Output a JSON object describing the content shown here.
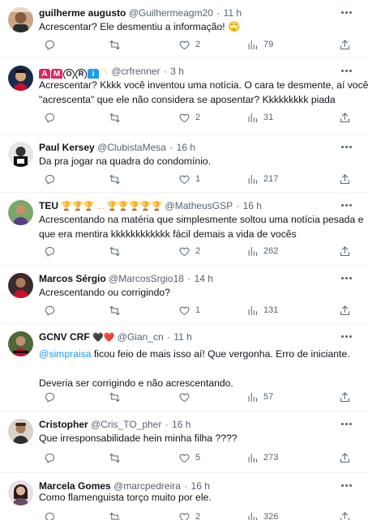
{
  "colors": {
    "accent": "#1d9bf0",
    "text": "#0f1419",
    "muted": "#536471",
    "divider": "#eff3f4"
  },
  "tweets": [
    {
      "name": "guilherme augusto",
      "handle": "@Guilhermeagm20",
      "time": "11 h",
      "text_lines": [
        "Acrescentar? Ele desmentiu a informação! 🙄"
      ],
      "replies": "",
      "retweets": "",
      "likes": "2",
      "views": "79"
    },
    {
      "name_badges": [
        "A",
        "M",
        "O",
        "R",
        "i",
        "〽"
      ],
      "handle": "@crfrenner",
      "time": "3 h",
      "text_lines": [
        "Acrescentar? Kkkk você inventou uma notícia. O cara te desmente, aí você",
        "\"acrescenta\" que ele não considera se aposentar? Kkkkkkkkk piada"
      ],
      "replies": "",
      "retweets": "",
      "likes": "2",
      "views": "31"
    },
    {
      "name": "Paul Kersey",
      "handle": "@ClubistaMesa",
      "time": "16 h",
      "text_lines": [
        "Da pra jogar na quadra do condomínio."
      ],
      "replies": "",
      "retweets": "",
      "likes": "1",
      "views": "217"
    },
    {
      "name": "TEU",
      "name_suffix": "🏆🏆🏆 ... 🏆🏆🏆🏆🏆",
      "handle": "@MatheusGSP",
      "time": "16 h",
      "text_lines": [
        "Acrescentando na matéria que simplesmente soltou uma notícia pesada e",
        "que era mentira  kkkkkkkkkkkk fácil demais a vida de vocês"
      ],
      "replies": "",
      "retweets": "",
      "likes": "2",
      "views": "262"
    },
    {
      "name": "Marcos Sérgio",
      "handle": "@MarcosSrgio18",
      "time": "14 h",
      "text_lines": [
        "Acrescentando ou corrigindo?"
      ],
      "replies": "",
      "retweets": "",
      "likes": "1",
      "views": "131"
    },
    {
      "name": "GCNV CRF",
      "name_suffix": "🖤❤️",
      "handle": "@Gian_cn",
      "time": "11 h",
      "mention": "@simpraisa",
      "text_lines": [
        " ficou feio de mais isso aí! Que vergonha. Erro de iniciante.",
        "",
        "Deveria ser corrigindo e não acrescentando."
      ],
      "replies": "",
      "retweets": "",
      "likes": "",
      "views": "57"
    },
    {
      "name": "Cristopher",
      "handle": "@Cris_TO_pher",
      "time": "16 h",
      "text_lines": [
        "Que irresponsabilidade hein minha filha ????"
      ],
      "replies": "",
      "retweets": "",
      "likes": "5",
      "views": "273"
    },
    {
      "name": "Marcela Gomes",
      "handle": "@marcpedreira",
      "time": "16 h",
      "text_lines": [
        "Como flamenguista torço muito por ele."
      ],
      "replies": "",
      "retweets": "",
      "likes": "2",
      "views": "326"
    }
  ],
  "icons": {
    "reply": "reply-icon",
    "retweet": "retweet-icon",
    "like": "heart-icon",
    "views": "views-icon",
    "bookmark": "bookmark-icon",
    "share": "share-icon",
    "more": "more-options-icon"
  }
}
